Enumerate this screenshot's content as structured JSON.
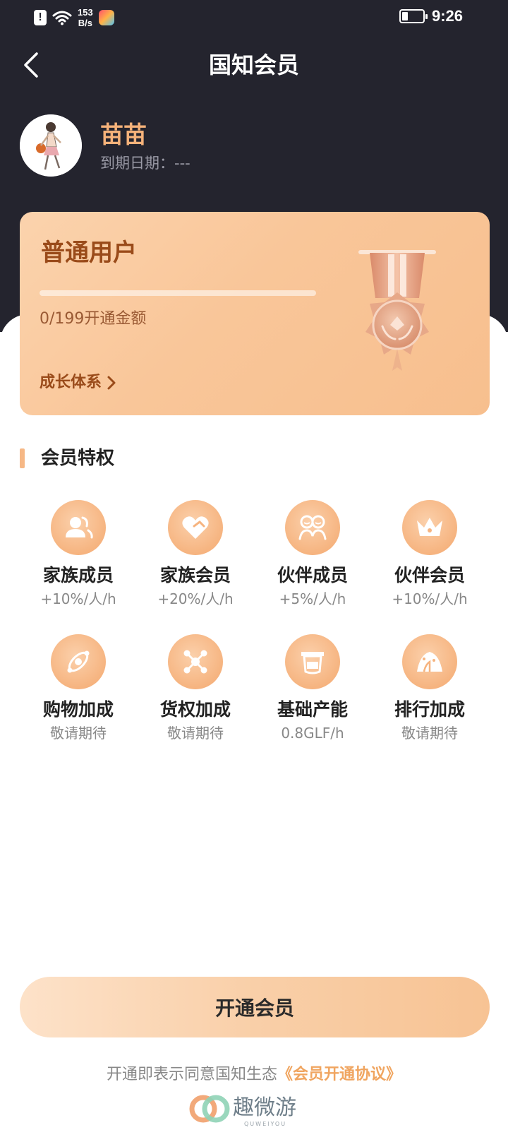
{
  "status_bar": {
    "network_speed_value": "153",
    "network_speed_unit": "B/s",
    "time": "9:26"
  },
  "header": {
    "title": "国知会员"
  },
  "profile": {
    "name": "苗苗",
    "expire_label": "到期日期：",
    "expire_value": "---"
  },
  "level_card": {
    "level_name": "普通用户",
    "progress_fraction": 0,
    "progress_text": "0/199开通金额",
    "growth_link": "成长体系"
  },
  "privileges": {
    "section_title": "会员特权",
    "items": [
      {
        "name": "家族成员",
        "value": "+10%/人/h",
        "icon": "user-group-icon"
      },
      {
        "name": "家族会员",
        "value": "+20%/人/h",
        "icon": "heart-handshake-icon"
      },
      {
        "name": "伙伴成员",
        "value": "+5%/人/h",
        "icon": "partners-icon"
      },
      {
        "name": "伙伴会员",
        "value": "+10%/人/h",
        "icon": "crown-icon"
      },
      {
        "name": "购物加成",
        "value": "敬请期待",
        "icon": "orbit-icon"
      },
      {
        "name": "货权加成",
        "value": "敬请期待",
        "icon": "network-icon"
      },
      {
        "name": "基础产能",
        "value": "0.8GLF/h",
        "icon": "capacity-icon"
      },
      {
        "name": "排行加成",
        "value": "敬请期待",
        "icon": "tent-icon"
      }
    ]
  },
  "actions": {
    "open_button": "开通会员",
    "agreement_prefix": "开通即表示同意国知生态",
    "agreement_link": "《会员开通协议》"
  },
  "watermark": {
    "text": "趣微游",
    "sub": "QUWEIYOU"
  },
  "colors": {
    "dark_bg": "#24242e",
    "accent": "#f6b886",
    "username": "#f5b27a",
    "link": "#f0a560"
  }
}
